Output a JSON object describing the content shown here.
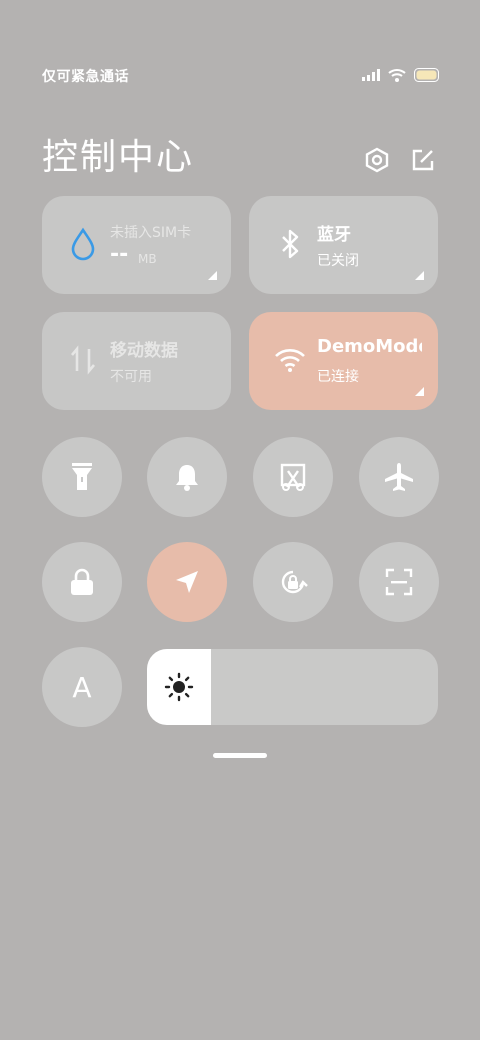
{
  "status": {
    "carrier": "仅可紧急通话",
    "icons": [
      "signal-icon",
      "wifi-icon",
      "battery-icon"
    ]
  },
  "header": {
    "title": "控制中心",
    "icons": [
      "settings-icon",
      "edit-icon"
    ]
  },
  "tiles": {
    "data_usage": {
      "label": "未插入SIM卡",
      "value": "--",
      "unit": "MB",
      "icon": "water-drop-icon"
    },
    "bluetooth": {
      "label": "蓝牙",
      "status": "已关闭",
      "icon": "bluetooth-icon"
    },
    "mobile_data": {
      "label": "移动数据",
      "status": "不可用",
      "icon": "mobile-data-icon"
    },
    "wifi": {
      "label": "DemoMode",
      "status": "已连接",
      "icon": "wifi-icon",
      "accent": "#e7bcaa"
    }
  },
  "toggles": {
    "row1": [
      "flashlight-icon",
      "bell-icon",
      "screenshot-icon",
      "airplane-icon"
    ],
    "row2": [
      "lock-icon",
      "location-icon",
      "rotation-lock-icon",
      "scan-icon"
    ]
  },
  "bottom": {
    "font_button": "A",
    "brightness_level": 0.22
  },
  "colors": {
    "accent": "#e7bcaa",
    "data_icon": "#3a9ae6",
    "background": "#b4b2b1"
  }
}
